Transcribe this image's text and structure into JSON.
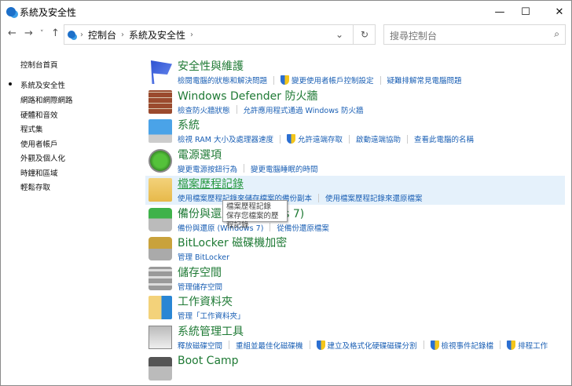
{
  "window": {
    "title": "系統及安全性",
    "minimize": "—",
    "maximize": "☐",
    "close": "✕"
  },
  "nav": {
    "back": "←",
    "forward": "→",
    "recent": "˅",
    "up": "↑",
    "refresh": "↻",
    "dropdown": "⌄"
  },
  "address": {
    "crumbs": [
      "控制台",
      "系統及安全性"
    ]
  },
  "search": {
    "placeholder": "搜尋控制台",
    "icon": "⌕"
  },
  "sidebar": {
    "home": "控制台首頁",
    "items": [
      "系統及安全性",
      "網路和網際網路",
      "硬體和音效",
      "程式集",
      "使用者帳戶",
      "外觀及個人化",
      "時鐘和區域",
      "輕鬆存取"
    ],
    "active": 0
  },
  "categories": [
    {
      "title": "安全性與維護",
      "icon": "flag-icon",
      "links": [
        {
          "label": "檢閱電腦的狀態和解決問題"
        },
        {
          "label": "變更使用者帳戶控制設定",
          "shield": true
        },
        {
          "label": "疑難排解常見電腦問題"
        }
      ]
    },
    {
      "title": "Windows Defender 防火牆",
      "icon": "firewall-icon",
      "links": [
        {
          "label": "檢查防火牆狀態"
        },
        {
          "label": "允許應用程式通過 Windows 防火牆"
        }
      ]
    },
    {
      "title": "系統",
      "icon": "computer-icon",
      "links": [
        {
          "label": "檢視 RAM 大小及處理器速度"
        },
        {
          "label": "允許遠端存取",
          "shield": true
        },
        {
          "label": "啟動遠端協助"
        },
        {
          "label": "查看此電腦的名稱"
        }
      ]
    },
    {
      "title": "電源選項",
      "icon": "power-icon",
      "links": [
        {
          "label": "變更電源按鈕行為"
        },
        {
          "label": "變更電腦睡眠的時間"
        }
      ]
    },
    {
      "title": "檔案歷程記錄",
      "icon": "file-history-icon",
      "links": [
        {
          "label": "使用檔案歷程記錄來儲存檔案的備份副本"
        },
        {
          "label": "使用檔案歷程記錄來還原檔案"
        }
      ]
    },
    {
      "title": "備份與還原 (Windows 7)",
      "icon": "backup-icon",
      "links": [
        {
          "label": "備份與還原 (Windows 7)"
        },
        {
          "label": "從備份還原檔案"
        }
      ]
    },
    {
      "title": "BitLocker 磁碟機加密",
      "icon": "bitlocker-icon",
      "links": [
        {
          "label": "管理 BitLocker"
        }
      ]
    },
    {
      "title": "儲存空間",
      "icon": "storage-icon",
      "links": [
        {
          "label": "管理儲存空間"
        }
      ]
    },
    {
      "title": "工作資料夾",
      "icon": "work-folders-icon",
      "links": [
        {
          "label": "管理「工作資料夾」"
        }
      ]
    },
    {
      "title": "系統管理工具",
      "icon": "admin-tools-icon",
      "links": [
        {
          "label": "釋放磁碟空間"
        },
        {
          "label": "重組並最佳化磁碟機"
        },
        {
          "label": "建立及格式化硬碟磁碟分割",
          "shield": true
        },
        {
          "label": "檢視事件記錄檔",
          "shield": true
        },
        {
          "label": "排程工作",
          "shield": true
        }
      ]
    },
    {
      "title": "Boot Camp",
      "icon": "bootcamp-icon",
      "links": []
    }
  ],
  "tooltip": {
    "line1": "檔案歷程記錄",
    "line2": "保存您檔案的歷程記錄"
  },
  "colors": {
    "title": "#1f7a35",
    "link": "#1a5fb4",
    "highlight": "#e5f1fb"
  }
}
